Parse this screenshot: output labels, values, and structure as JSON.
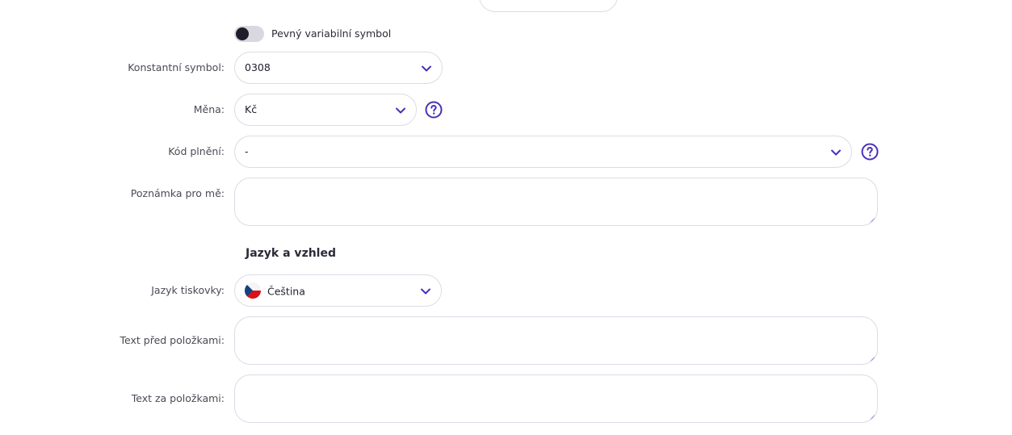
{
  "fields": {
    "fixed_variable_symbol": {
      "label": "Pevný variabilní symbol",
      "enabled": false
    },
    "constant_symbol": {
      "label": "Konstantní symbol:",
      "value": "0308"
    },
    "currency": {
      "label": "Měna:",
      "value": "Kč"
    },
    "performance_code": {
      "label": "Kód plnění:",
      "value": "-"
    },
    "note": {
      "label": "Poznámka pro mě:",
      "value": ""
    }
  },
  "language_section": {
    "title": "Jazyk a vzhled",
    "print_language": {
      "label": "Jazyk tiskovky:",
      "value": "Čeština",
      "flag_icon": "czech-flag-icon"
    },
    "text_before_items": {
      "label": "Text před položkami:",
      "value": ""
    },
    "text_after_items": {
      "label": "Text za položkami:",
      "value": ""
    }
  },
  "icons": {
    "chevron": "chevron-down-icon",
    "help": "question-circle-icon",
    "resize": "resize-grip-icon"
  },
  "colors": {
    "accent": "#4a2fbd",
    "border": "#dcdbe5",
    "label": "#4a4a55",
    "toggle_off": "#d9d8e0",
    "toggle_knob": "#1f1d2b"
  }
}
